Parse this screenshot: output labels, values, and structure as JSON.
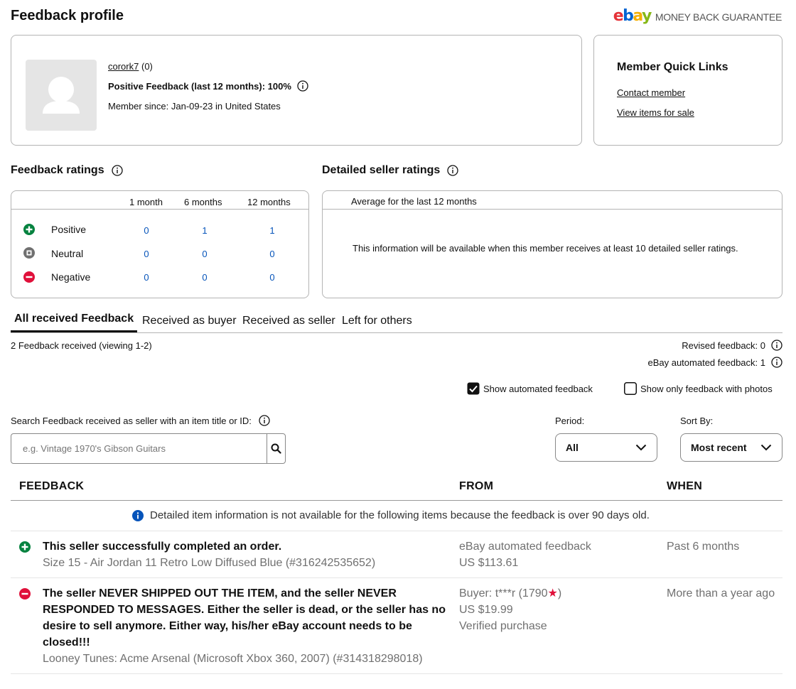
{
  "header": {
    "title": "Feedback profile",
    "brand_logo": "ebay",
    "brand_tagline": "MONEY BACK GUARANTEE"
  },
  "profile": {
    "username": "corork7",
    "score": "(0)",
    "positive_feedback": "Positive Feedback (last 12 months): 100%",
    "member_since": "Member since: Jan-09-23 in United States"
  },
  "quick_links": {
    "title": "Member Quick Links",
    "contact": "Contact member",
    "view_items": "View items for sale"
  },
  "feedback_ratings": {
    "title": "Feedback ratings",
    "columns": [
      "1 month",
      "6 months",
      "12 months"
    ],
    "rows": [
      {
        "label": "Positive",
        "values": [
          "0",
          "1",
          "1"
        ],
        "color": "#05823f"
      },
      {
        "label": "Neutral",
        "values": [
          "0",
          "0",
          "0"
        ],
        "color": "#707070"
      },
      {
        "label": "Negative",
        "values": [
          "0",
          "0",
          "0"
        ],
        "color": "#e0103a"
      }
    ]
  },
  "detailed_ratings": {
    "title": "Detailed seller ratings",
    "subheader": "Average for the last 12 months",
    "message": "This information will be available when this member receives at least 10 detailed seller ratings."
  },
  "tabs": [
    "All received Feedback",
    "Received as buyer",
    "Received as seller",
    "Left for others"
  ],
  "summary": {
    "received": "2 Feedback received (viewing 1-2)",
    "revised": "Revised feedback: 0",
    "automated": "eBay automated feedback: 1"
  },
  "filters": {
    "show_automated": "Show automated feedback",
    "show_photos": "Show only feedback with photos",
    "search_label": "Search Feedback received as seller with an item title or ID:",
    "search_placeholder": "e.g. Vintage 1970's Gibson Guitars",
    "period_label": "Period:",
    "period_value": "All",
    "sort_label": "Sort By:",
    "sort_value": "Most recent"
  },
  "table": {
    "headers": [
      "FEEDBACK",
      "FROM",
      "WHEN"
    ],
    "notice": "Detailed item information is not available for the following items because the feedback is over 90 days old.",
    "rows": [
      {
        "type": "positive",
        "text": "This seller successfully completed an order.",
        "item": "Size 15 - Air Jordan 11 Retro Low Diffused Blue (#316242535652)",
        "from": "eBay automated feedback",
        "price": "US $113.61",
        "when": "Past 6 months"
      },
      {
        "type": "negative",
        "text": "The seller NEVER SHIPPED OUT THE ITEM, and the seller NEVER RESPONDED TO MESSAGES. Either the seller is dead, or the seller has no desire to sell anymore. Either way, his/her eBay account needs to be closed!!!",
        "item": "Looney Tunes: Acme Arsenal (Microsoft Xbox 360, 2007) (#314318298018)",
        "from_prefix": "Buyer: t***r (1790",
        "from_suffix": ")",
        "price": "US $19.99",
        "verified": "Verified purchase",
        "when": "More than a year ago"
      }
    ]
  }
}
